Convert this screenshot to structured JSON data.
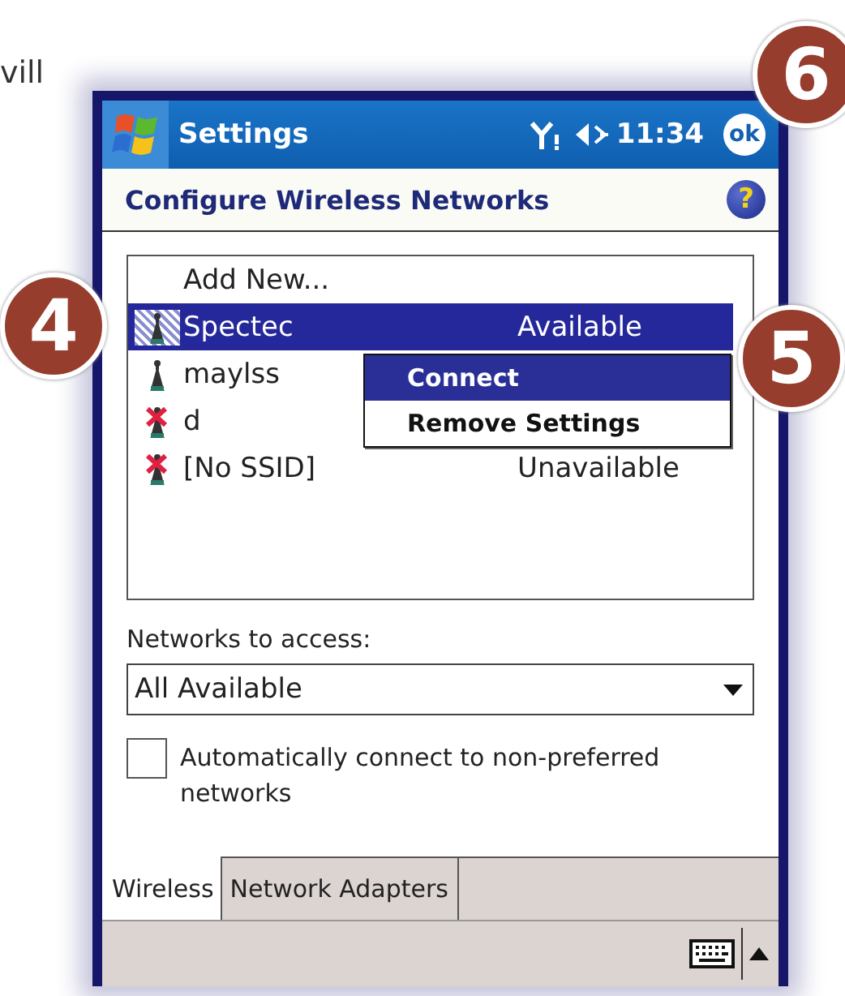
{
  "page_text": "vill",
  "callouts": [
    {
      "number": "6"
    },
    {
      "number": "4"
    },
    {
      "number": "5"
    }
  ],
  "title_bar": {
    "title": "Settings",
    "time": "11:34",
    "ok": "ok"
  },
  "header": {
    "title": "Configure Wireless Networks",
    "help": "?"
  },
  "networks": [
    {
      "kind": "add",
      "name": "Add New...",
      "selected": false
    },
    {
      "kind": "network",
      "name": "Spectec",
      "status": "Available",
      "reachable": true,
      "selected": true
    },
    {
      "kind": "network",
      "name": "maylss",
      "reachable": true,
      "selected": false
    },
    {
      "kind": "network",
      "name": "d",
      "reachable": false,
      "selected": false
    },
    {
      "kind": "network",
      "name": "[No SSID]",
      "status": "Unavailable",
      "reachable": false,
      "selected": false
    }
  ],
  "context_menu": [
    {
      "label": "Connect",
      "selected": true
    },
    {
      "label": "Remove Settings",
      "selected": false
    }
  ],
  "access": {
    "label": "Networks to access:",
    "value": "All Available"
  },
  "auto_connect": {
    "label": "Automatically connect to non-preferred networks",
    "checked": false
  },
  "tabs": [
    {
      "label": "Wireless",
      "selected": true
    },
    {
      "label": "Network Adapters",
      "selected": false
    }
  ]
}
